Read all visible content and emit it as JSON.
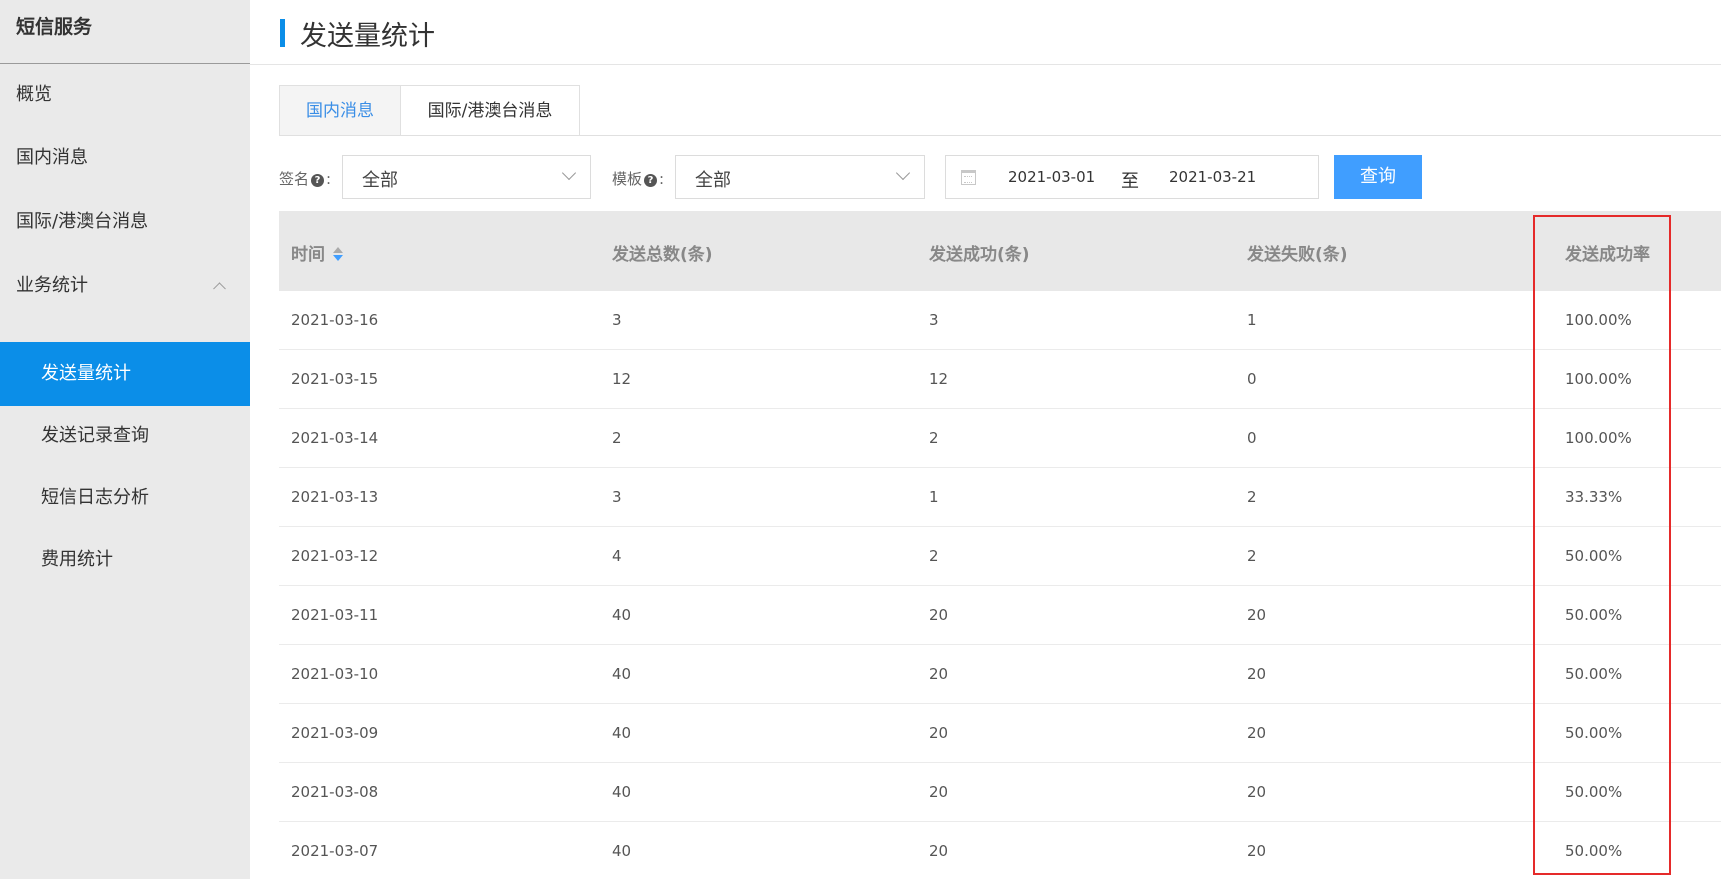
{
  "sidebar": {
    "title": "短信服务",
    "items": [
      {
        "label": "概览"
      },
      {
        "label": "国内消息"
      },
      {
        "label": "国际/港澳台消息"
      },
      {
        "label": "业务统计"
      },
      {
        "label": "发送量统计"
      },
      {
        "label": "发送记录查询"
      },
      {
        "label": "短信日志分析"
      },
      {
        "label": "费用统计"
      }
    ]
  },
  "header": {
    "title": "发送量统计"
  },
  "tabs": [
    {
      "label": "国内消息",
      "active": true
    },
    {
      "label": "国际/港澳台消息",
      "active": false
    }
  ],
  "filters": {
    "signature_label": "签名",
    "signature_colon": ":",
    "signature_value": "全部",
    "template_label": "模板",
    "template_colon": ":",
    "template_value": "全部",
    "help_glyph": "?",
    "date_start": "2021-03-01",
    "date_separator": "至",
    "date_end": "2021-03-21",
    "query_label": "查询"
  },
  "table": {
    "columns": [
      "时间",
      "发送总数(条)",
      "发送成功(条)",
      "发送失败(条)",
      "发送成功率"
    ],
    "rows": [
      [
        "2021-03-16",
        "3",
        "3",
        "1",
        "100.00%"
      ],
      [
        "2021-03-15",
        "12",
        "12",
        "0",
        "100.00%"
      ],
      [
        "2021-03-14",
        "2",
        "2",
        "0",
        "100.00%"
      ],
      [
        "2021-03-13",
        "3",
        "1",
        "2",
        "33.33%"
      ],
      [
        "2021-03-12",
        "4",
        "2",
        "2",
        "50.00%"
      ],
      [
        "2021-03-11",
        "40",
        "20",
        "20",
        "50.00%"
      ],
      [
        "2021-03-10",
        "40",
        "20",
        "20",
        "50.00%"
      ],
      [
        "2021-03-09",
        "40",
        "20",
        "20",
        "50.00%"
      ],
      [
        "2021-03-08",
        "40",
        "20",
        "20",
        "50.00%"
      ],
      [
        "2021-03-07",
        "40",
        "20",
        "20",
        "50.00%"
      ]
    ]
  },
  "colors": {
    "accent": "#0b8ee8",
    "button": "#409eff",
    "highlight": "#e52a2a"
  }
}
